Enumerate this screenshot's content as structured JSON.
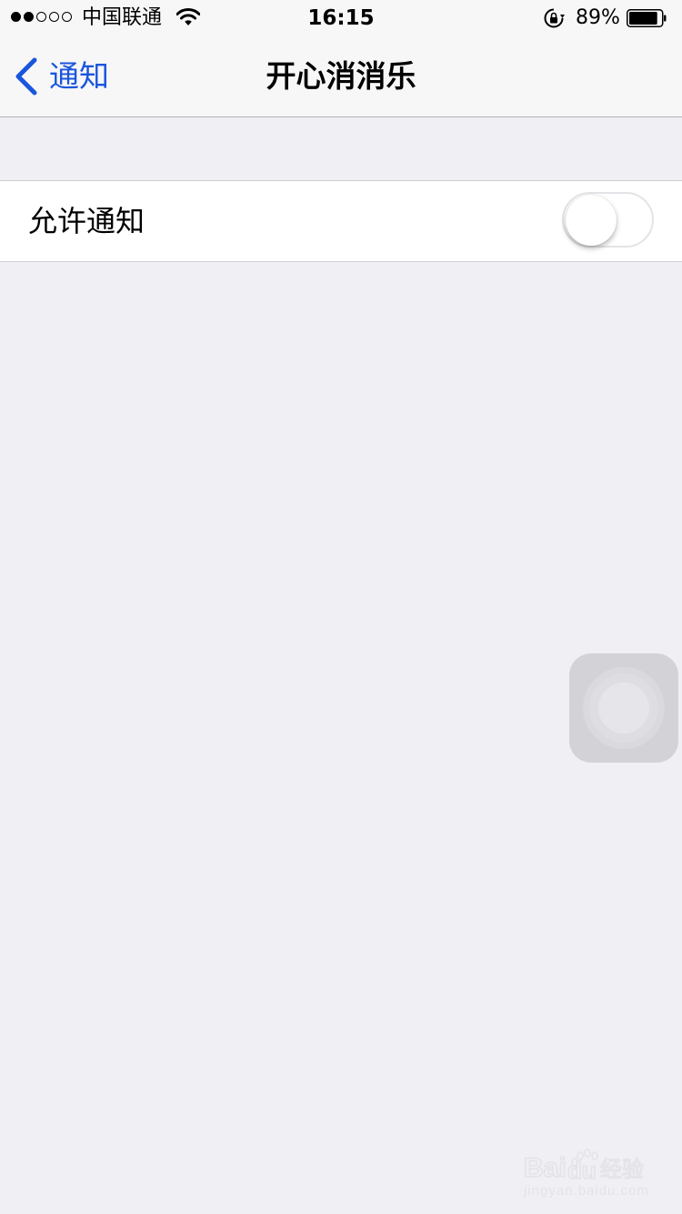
{
  "status_bar": {
    "signal_dots": [
      true,
      true,
      false,
      false,
      false
    ],
    "carrier": "中国联通",
    "time": "16:15",
    "battery_percent": "89%",
    "battery_level": 0.89,
    "icons": [
      "wifi-icon",
      "rotation-lock-icon",
      "battery-icon"
    ]
  },
  "nav": {
    "back_label": "通知",
    "title": "开心消消乐"
  },
  "settings": {
    "allow_notifications": {
      "label": "允许通知",
      "enabled": false
    }
  },
  "assistive_touch": {
    "icon": "assistive-touch-icon"
  },
  "watermark": {
    "text": "Baidu经验",
    "subtext": "jingyan.baidu.com"
  },
  "colors": {
    "accent": "#1a56db",
    "background": "#efeff4",
    "bar_background": "#f7f7f8"
  }
}
